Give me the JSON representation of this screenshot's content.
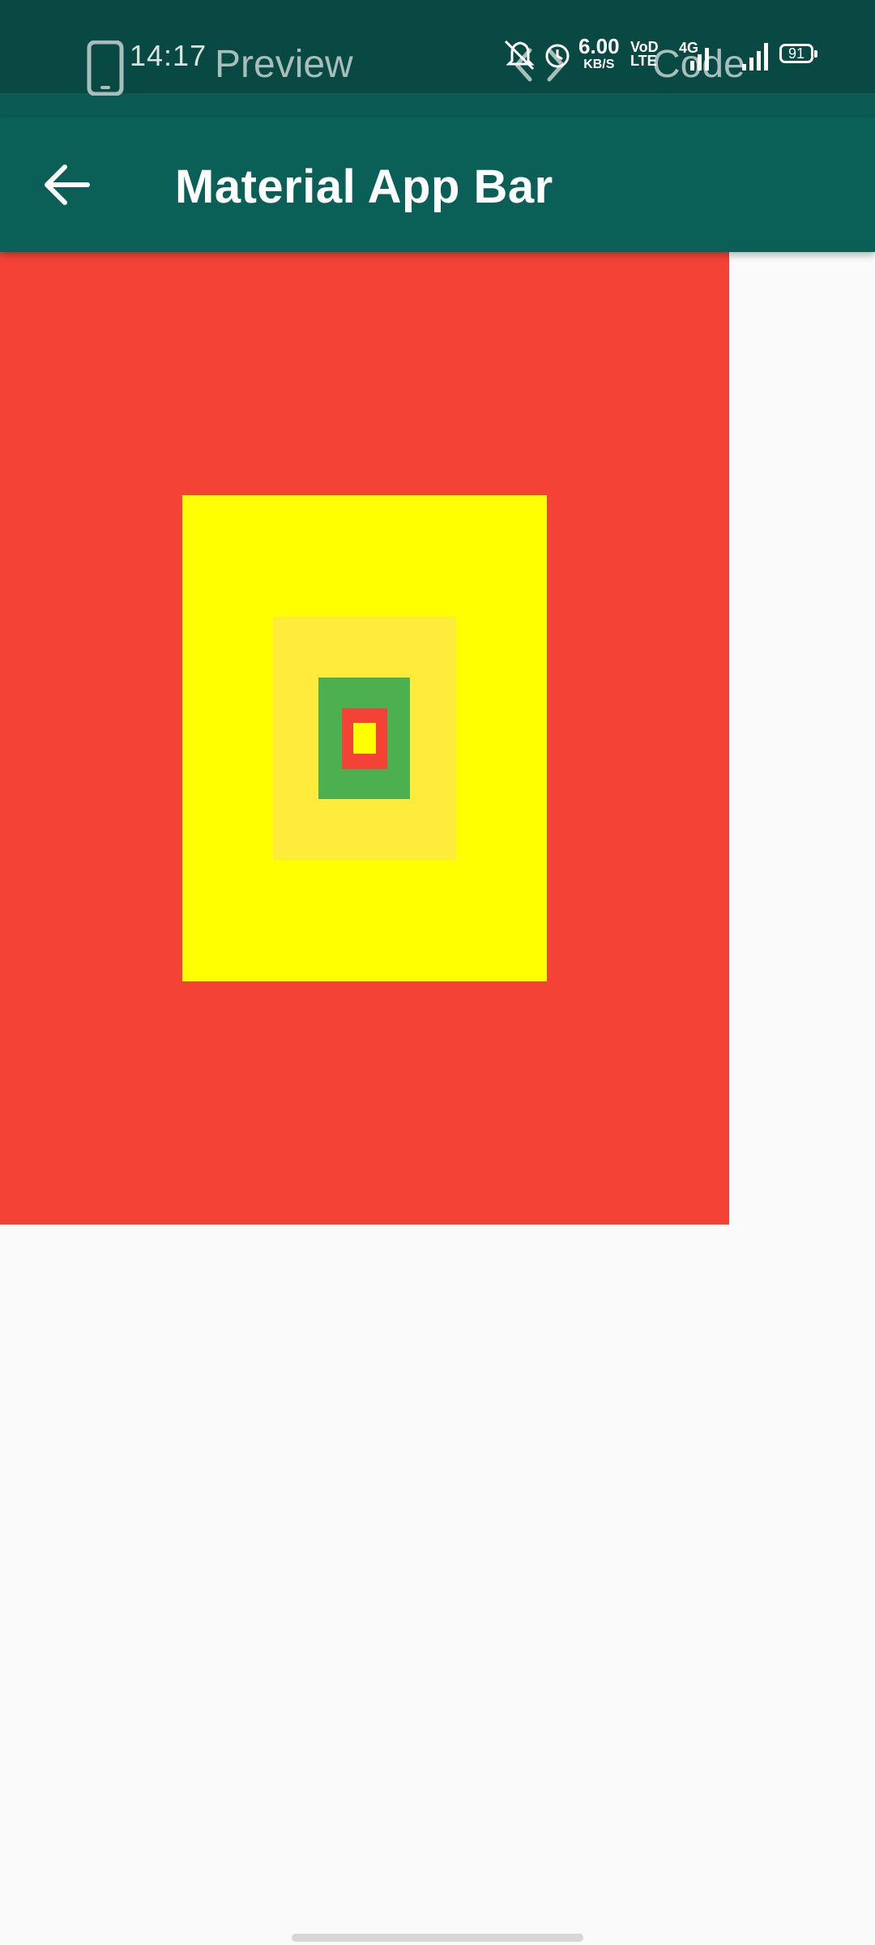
{
  "status_bar": {
    "time": "14:17",
    "net_speed_value": "6.00",
    "net_speed_unit": "KB/S",
    "volte_line1": "VoD",
    "volte_line2": "LTE",
    "network": "4G",
    "battery": "91"
  },
  "preview_tabs": {
    "preview_label": "Preview",
    "code_label": "Code"
  },
  "app_bar": {
    "title": "Material App Bar",
    "back_icon": "arrow-back-icon"
  },
  "colors": {
    "status_bar": "#084943",
    "app_bar": "#0a5f57",
    "background": "#fafafa",
    "red": "#f44336",
    "yellow": "#ffff00",
    "yellow_soft": "#ffeb3b",
    "green": "#4caf50"
  },
  "containers": [
    {
      "name": "red-outer",
      "color": "red"
    },
    {
      "name": "yellow-main",
      "color": "yellow"
    },
    {
      "name": "yellow-soft",
      "color": "yellow_soft"
    },
    {
      "name": "green-box",
      "color": "green"
    },
    {
      "name": "red-inner",
      "color": "red"
    },
    {
      "name": "yellow-core",
      "color": "yellow"
    }
  ]
}
